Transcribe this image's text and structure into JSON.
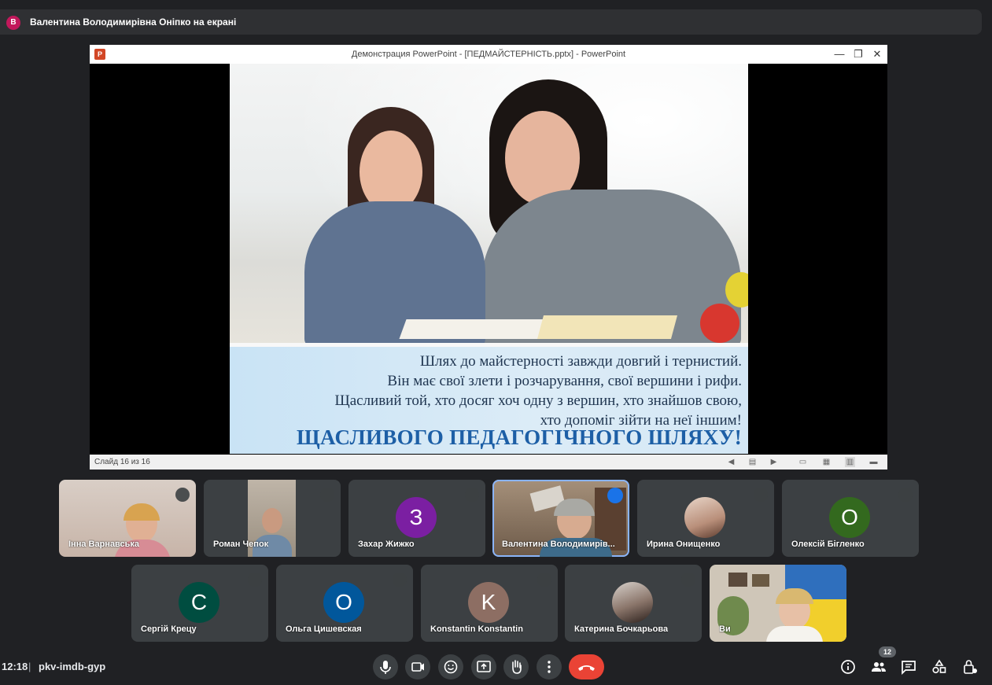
{
  "presenter": {
    "avatar_letter": "В",
    "label": "Валентина Володимирівна Оніпко на екрані"
  },
  "ppt": {
    "icon_letter": "P",
    "title": "Демонстрация PowerPoint - [ПЕДМАЙСТЕРНІСТЬ.pptx] - PowerPoint",
    "controls": [
      "minimize-icon",
      "restore-icon",
      "close-icon"
    ],
    "status": "Слайд 16 из 16",
    "slide": {
      "lines": [
        "Шлях до майстерності завжди довгий і тернистий.",
        "Він має свої злети і розчарування, свої вершини і рифи.",
        "Щасливий той, хто досяг хоч одну з вершин, хто знайшов свою,",
        "хто допоміг зійти на неї іншим!"
      ],
      "headline": "ЩАСЛИВОГО ПЕДАГОГІЧНОГО ШЛЯХУ!"
    }
  },
  "participants": [
    {
      "name": "Інна Варнавська",
      "type": "video"
    },
    {
      "name": "Роман Чепок",
      "type": "video"
    },
    {
      "name": "Захар Жижко",
      "type": "avatar",
      "letter": "З",
      "color": "#7b1fa2"
    },
    {
      "name": "Валентина Володимирів...",
      "type": "video",
      "speaking": true
    },
    {
      "name": "Ирина Онищенко",
      "type": "photo"
    },
    {
      "name": "Олексій Бігленко",
      "type": "avatar",
      "letter": "О",
      "color": "#33691e"
    },
    {
      "name": "Сергій Крецу",
      "type": "avatar",
      "letter": "С",
      "color": "#004d40"
    },
    {
      "name": "Ольга Цишевская",
      "type": "avatar",
      "letter": "О",
      "color": "#01579b"
    },
    {
      "name": "Konstantin Konstantin",
      "type": "avatar",
      "letter": "K",
      "color": "#8d6e63"
    },
    {
      "name": "Катерина Бочкарьова",
      "type": "photo"
    },
    {
      "name": "Ви",
      "type": "video"
    }
  ],
  "meeting": {
    "time": "12:18",
    "separator": "|",
    "code": "pkv-imdb-gyp",
    "people_count": "12"
  },
  "controls": [
    "mic-icon",
    "camera-icon",
    "emoji-icon",
    "present-icon",
    "raise-hand-icon",
    "more-options-icon",
    "end-call-icon"
  ],
  "right_controls": [
    "info-icon",
    "people-icon",
    "chat-icon",
    "activities-icon",
    "host-controls-icon"
  ],
  "colors": {
    "background": "#202124",
    "tile": "#3c4043",
    "end_call": "#ea4335",
    "accent": "#8ab4f8"
  }
}
